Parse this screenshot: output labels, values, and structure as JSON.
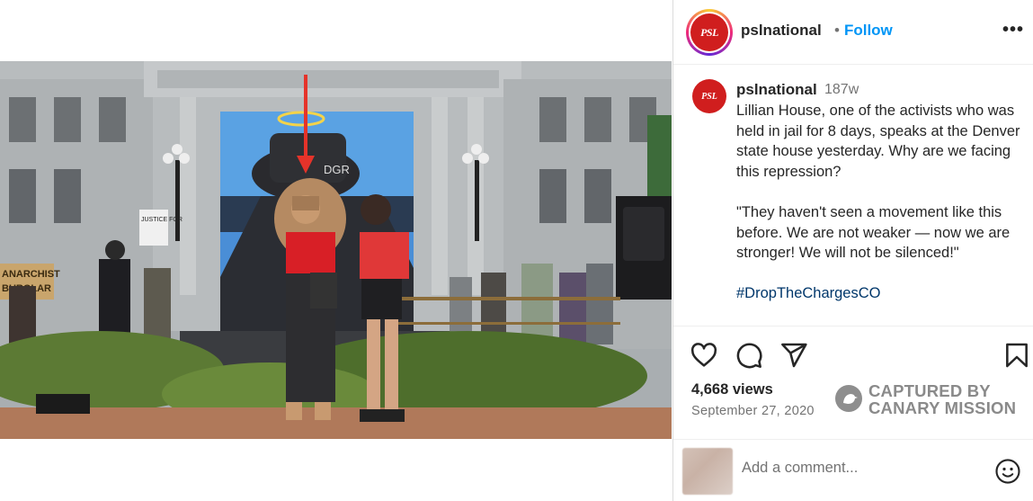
{
  "header": {
    "username": "pslnational",
    "separator": "•",
    "follow_label": "Follow",
    "more_label": "•••",
    "avatar_text": "PSL"
  },
  "caption": {
    "username": "pslnational",
    "time_ago": "187w",
    "paragraphs": [
      "Lillian House, one of the activists who was held in jail for 8 days, speaks at the Denver state house yesterday. Why are we facing this repression?",
      "\"They haven't seen a movement like this before. We are not weaker — now we are stronger! We will not be silenced!\""
    ],
    "hashtag": "#DropTheChargesCO"
  },
  "actions": {
    "like_icon": "heart-icon",
    "comment_icon": "comment-icon",
    "share_icon": "share-icon",
    "save_icon": "bookmark-icon"
  },
  "stats": {
    "views": "4,668 views",
    "date": "September 27, 2020"
  },
  "watermark": {
    "line1": "CAPTURED BY",
    "line2": "CANARY MISSION"
  },
  "comment": {
    "placeholder": "Add a comment...",
    "emoji_icon": "smiley-icon"
  },
  "video": {
    "mute_icon": "speaker-muted-icon",
    "sign_left": "ANARCHIST",
    "sign_left_2": "BURGLAR",
    "sign_post": "JUSTICE FOR",
    "hat_text": "DGR"
  },
  "colors": {
    "accent": "#0095f6",
    "brand_red": "#d01e1e",
    "hashtag": "#00376b",
    "annotation_arrow": "#e5332a"
  }
}
